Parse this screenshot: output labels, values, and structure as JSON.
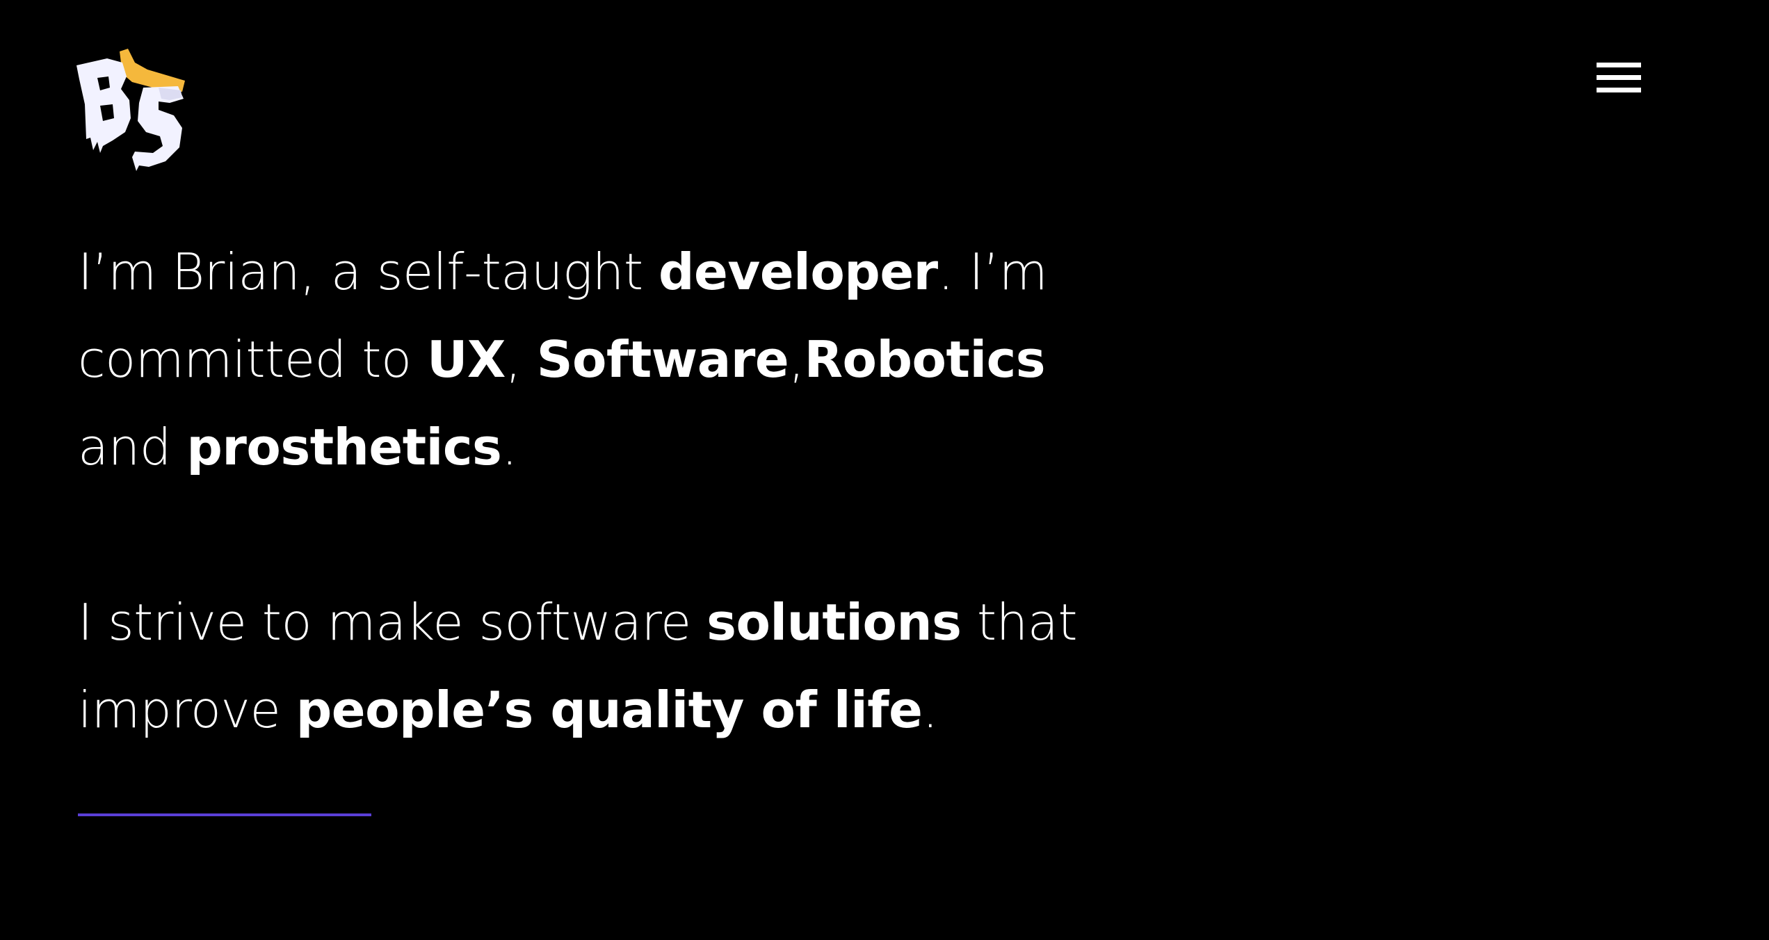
{
  "header": {
    "logo": {
      "icon": "bs-monogram-logo",
      "text": "BS",
      "accent_color": "#f5b83c"
    },
    "menu": {
      "icon": "hamburger-menu-icon"
    }
  },
  "intro": {
    "part1": "I’m Brian, a self-taught ",
    "bold1": "developer",
    "part2": ". I’m committed to ",
    "bold2": "UX",
    "part3": ", ",
    "bold3": "Software",
    "part4": ",",
    "bold4": "Robotics",
    "part5": " and ",
    "bold5": "prosthetics",
    "part6": "."
  },
  "mission": {
    "part1": "I strive to make software ",
    "bold1": "solutions",
    "part2": " that improve ",
    "bold2": "people’s quality of life",
    "part3": "."
  },
  "colors": {
    "background": "#000000",
    "text": "#ffffff",
    "accent_line": "#5a3fd6",
    "logo_accent": "#f5b83c"
  }
}
